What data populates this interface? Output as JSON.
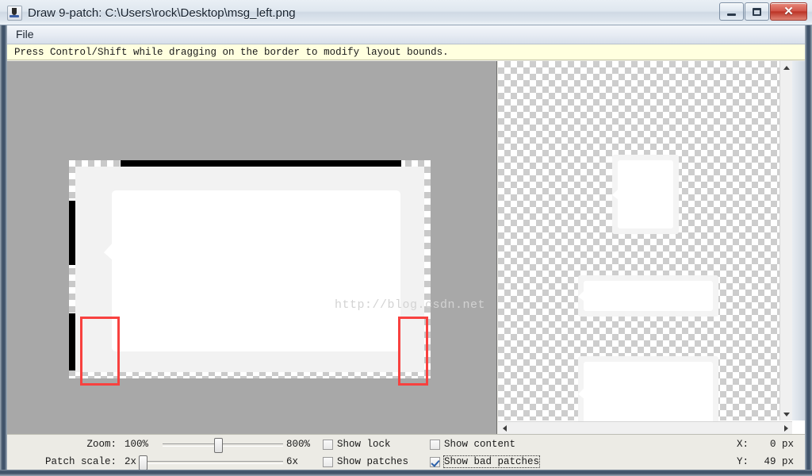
{
  "window": {
    "title": "Draw 9-patch: C:\\Users\\rock\\Desktop\\msg_left.png",
    "icon": "java-app-icon",
    "buttons": {
      "minimize": "minimize-icon",
      "maximize": "maximize-icon",
      "close": "✕"
    }
  },
  "menubar": {
    "items": [
      {
        "label": "File"
      }
    ]
  },
  "hint": {
    "text": "Press Control/Shift while dragging on the border to modify layout bounds."
  },
  "canvas": {
    "watermark": "http://blog.csdn.net",
    "bad_patches": 2
  },
  "controls": {
    "zoom": {
      "label": "Zoom:",
      "min_label": "100%",
      "max_label": "800%",
      "value_percent": 45
    },
    "patch_scale": {
      "label": "Patch scale:",
      "min_label": "2x",
      "max_label": "6x",
      "value_percent": 0
    },
    "checkboxes": [
      {
        "label": "Show lock",
        "checked": false,
        "focused": false
      },
      {
        "label": "Show patches",
        "checked": false,
        "focused": false
      },
      {
        "label": "Show content",
        "checked": false,
        "focused": false
      },
      {
        "label": "Show bad patches",
        "checked": true,
        "focused": true
      }
    ],
    "coords": {
      "x_label": "X:",
      "x_value": "0 px",
      "y_label": "Y:",
      "y_value": "49 px"
    }
  },
  "colors": {
    "bad_patch_red": "#f8413f",
    "hint_background": "#ffffdf",
    "canvas_background": "#a8a8a8",
    "checkbox_check": "#2a5fa8"
  },
  "scrollbars": {
    "vertical": {
      "up": "arrow-up-icon",
      "down": "arrow-down-icon"
    },
    "horizontal": {
      "left": "arrow-left-icon",
      "right": "arrow-right-icon"
    }
  }
}
